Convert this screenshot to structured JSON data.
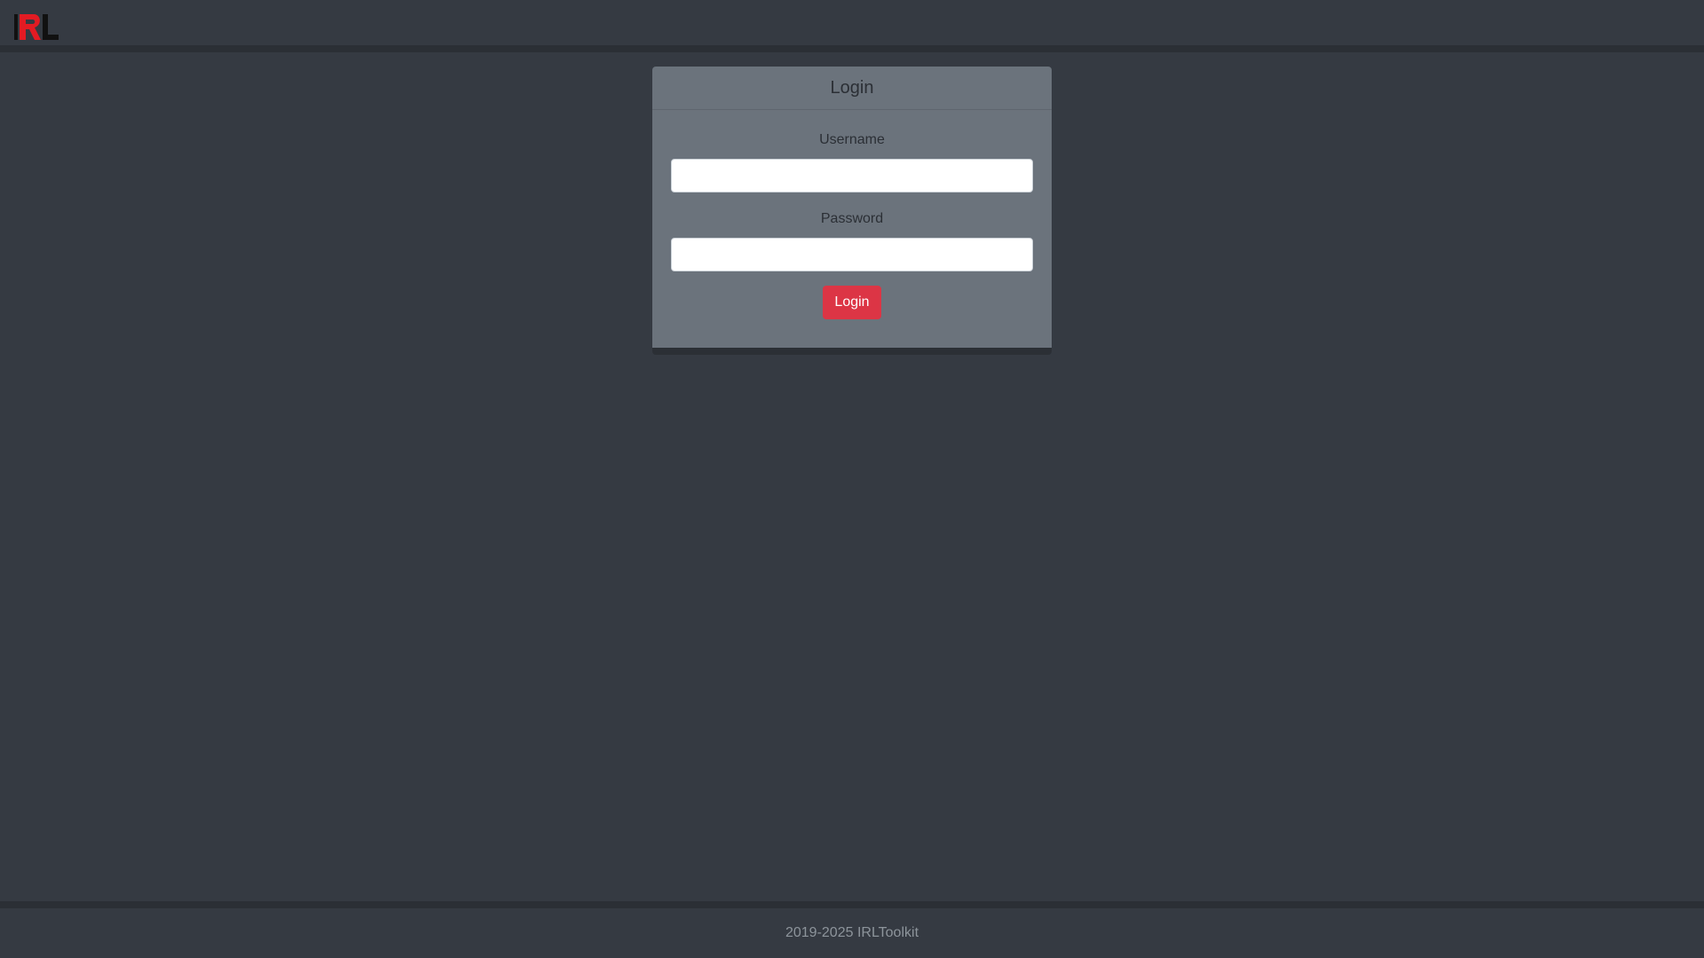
{
  "header": {
    "logo_icon": "irl-logo-icon",
    "logo_text": "IRL"
  },
  "login": {
    "title": "Login",
    "username_label": "Username",
    "username_value": "",
    "password_label": "Password",
    "password_value": "",
    "submit_label": "Login"
  },
  "footer": {
    "text": "2019-2025 IRLToolkit"
  },
  "colors": {
    "background": "#353a42",
    "border": "#2b2f35",
    "card": "#6b737c",
    "accent": "#dc3545",
    "logo_red": "#e31b23"
  }
}
